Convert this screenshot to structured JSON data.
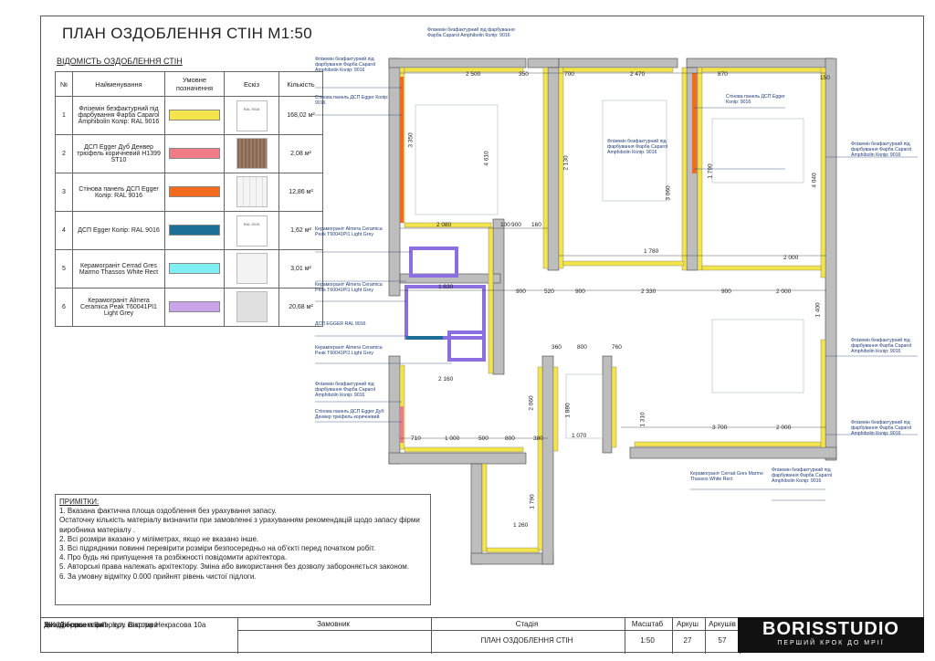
{
  "title": "ПЛАН ОЗДОБЛЕННЯ СТІН М1:50",
  "schedule": {
    "subtitle": "ВІДОМІСТЬ ОЗДОБЛЕННЯ СТІН",
    "headers": [
      "№",
      "Найменування",
      "Умовне позначення",
      "Ескіз",
      "Кількість"
    ],
    "rows": [
      {
        "num": "1",
        "name": "Фліземін безфактурний під фарбування Фарба Caparol Amphibolin Колір: RAL 9016",
        "color": "#f2e44a",
        "sketch": "RAL 9016",
        "qty": "168,02 м²"
      },
      {
        "num": "2",
        "name": "ДСП Egger Дуб Денвер трюфель коричневий H1399 ST10",
        "color": "#f07a86",
        "sketch": "",
        "qty": "2,08 м²"
      },
      {
        "num": "3",
        "name": "Стінова панель ДСП Egger Колір: RAL 9016",
        "color": "#f26a1b",
        "sketch": "",
        "qty": "12,86 м²"
      },
      {
        "num": "4",
        "name": "ДСП Egger Колір: RAL 9016",
        "color": "#1c6f99",
        "sketch": "RAL 9016",
        "qty": "1,62 м²"
      },
      {
        "num": "5",
        "name": "Керамограніт Cerrad Gres Marmo Thassos White Rect",
        "color": "#7feff2",
        "sketch": "",
        "qty": "3,01 м²"
      },
      {
        "num": "6",
        "name": "Керамограніт Almera Ceramica Peak T60041PI1 Light Grey",
        "color": "#c9a4e9",
        "sketch": "",
        "qty": "20,68 м²"
      }
    ]
  },
  "notes": {
    "heading": "ПРИМІТКИ:",
    "lines": [
      "1. Вказана фактична площа оздоблення без урахування запасу.",
      "Остаточну кількість матеріалу визначити при замовленні з урахуванням рекомендацій щодо запасу фірми виробника матеріалу .",
      "2. Всі розміри вказано у міліметрах, якщо не вказано інше.",
      "3. Всі підрядники повинні перевірити розміри безпосередньо на об'єкті перед початком робіт.",
      "4. Про будь які припущення та розбіжності повідомити архітектора.",
      "5. Авторські права належать архітектору. Зміна або використання без дозволу забороняється законом.",
      "6. За умовну відмітку 0.000 прийнят рівень чистої підлоги."
    ]
  },
  "plan_labels": [
    "Фліземін безфактурний під фарбування Фарба Caparol Amphibolin Колір: 9016",
    "Фліземін безфактурний під фарбування Фарба Caparol Amphibolin Колір: 9016",
    "Стінова панель ДСП Egger Колір: 9016",
    "Стінова панель ДСП Egger Колір: 9016",
    "Фліземін безфактурний під фарбування Фарба Caparol Amphibolin Колір: 9016",
    "Фліземін безфактурний під фарбування Фарба Caparol Amphibolin Колір: 9016",
    "Керамограніт Almera Ceramica Peak T60041PI1 Light Grey",
    "Керамограніт Almera Ceramica Peak T60041PI1 Light Grey",
    "ДСП EGGER RAL 9016",
    "Керамограніт Almera Ceramica Peak T60041PI1 Light Grey",
    "Фліземін безфактурний під фарбування Фарба Caparol Amphibolin Колір: 9016",
    "Стінова панель ДСП Egger Дуб Денвер трюфель коричневий",
    "Фліземін безфактурний під фарбування Фарба Caparol Amphibolin Колір: 9016",
    "Фліземін безфактурний під фарбування Фарба Caparol Amphibolin Колір: 9016",
    "Керамограніт Cerrad Gres Marmo Thassos White Rect",
    "Фліземін безфактурний під фарбування Фарба Caparol Amphibolin Колір: 9016"
  ],
  "dimensions": [
    "2 500",
    "350",
    "700",
    "2 470",
    "870",
    "150",
    "2 080",
    "100",
    "900",
    "160",
    "1 830",
    "900",
    "520",
    "900",
    "2 330",
    "900",
    "2 000",
    "1 780",
    "2 000",
    "2 160",
    "360",
    "800",
    "760",
    "3 700",
    "2 000",
    "710",
    "1 000",
    "500",
    "800",
    "380",
    "1 070",
    "1 260",
    "4 610",
    "3 350",
    "2 130",
    "3 060",
    "4 040",
    "1 790",
    "1 400",
    "2 060",
    "1 790",
    "1 880",
    "1 310"
  ],
  "titleblock": {
    "project": "Дизайн-проект інтер'єру квартири",
    "complex": "ЖК \"Діброва парк\"",
    "address": "за адресою: м.Київ, вул. Віктора Некрасова 10а",
    "customer_label": "Замовник",
    "stage_label": "Стадія",
    "sheet_name": "ПЛАН ОЗДОБЛЕННЯ СТІН",
    "scale_label": "Масштаб",
    "scale": "1:50",
    "sheet_label": "Аркуш",
    "sheet": "27",
    "sheets_label": "Аркушів",
    "sheets": "57"
  },
  "logo": {
    "name": "BORISSTUDIO",
    "tagline": "ПЕРШИЙ КРОК ДО МРІЇ"
  }
}
